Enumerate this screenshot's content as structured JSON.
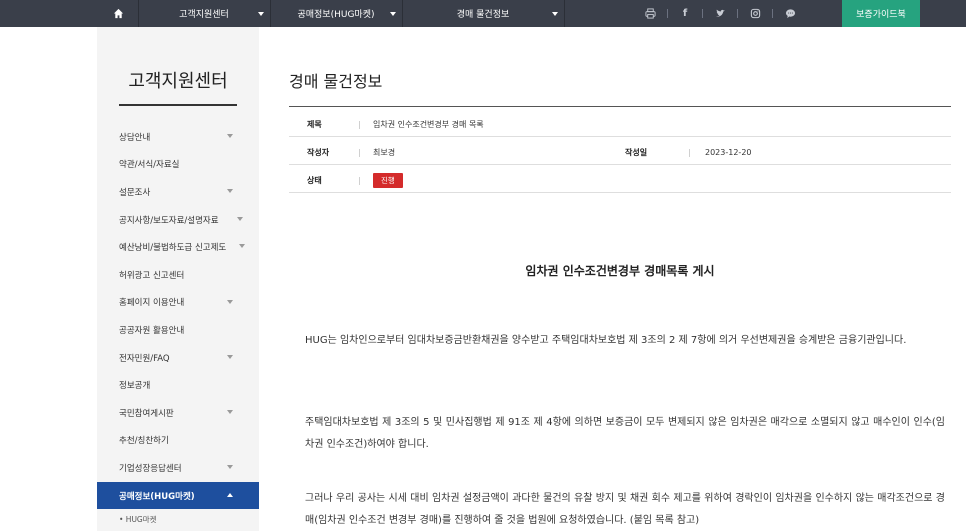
{
  "topbar": {
    "home_icon": "home-icon",
    "menus": [
      {
        "label": "고객지원센터"
      },
      {
        "label": "공매정보(HUG마켓)"
      },
      {
        "label": "경매 물건정보"
      }
    ],
    "icons": [
      "print-icon",
      "facebook-icon",
      "twitter-icon",
      "instagram-icon",
      "chat-icon"
    ],
    "guide_label": "보증가이드북",
    "colors": {
      "bar": "#3a3f4a",
      "guide": "#26a37f"
    }
  },
  "sidebar": {
    "title": "고객지원센터",
    "items": [
      {
        "label": "상담안내",
        "has_arrow": true
      },
      {
        "label": "약관/서식/자료실",
        "has_arrow": false
      },
      {
        "label": "설문조사",
        "has_arrow": true
      },
      {
        "label": "공지사항/보도자료/설명자료",
        "has_arrow": true
      },
      {
        "label": "예산낭비/불법하도급 신고제도",
        "has_arrow": true
      },
      {
        "label": "허위광고 신고센터",
        "has_arrow": false
      },
      {
        "label": "홈페이지 이용안내",
        "has_arrow": true
      },
      {
        "label": "공공자원 활용안내",
        "has_arrow": false
      },
      {
        "label": "전자민원/FAQ",
        "has_arrow": true
      },
      {
        "label": "정보공개",
        "has_arrow": false
      },
      {
        "label": "국민참여게시판",
        "has_arrow": true
      },
      {
        "label": "추천/칭찬하기",
        "has_arrow": false
      },
      {
        "label": "기업성장응답센터",
        "has_arrow": true
      },
      {
        "label": "공매정보(HUG마켓)",
        "has_arrow": true,
        "active": true
      }
    ],
    "sub_items": [
      {
        "label": "• HUG마켓"
      }
    ],
    "colors": {
      "active": "#1e4f9e"
    }
  },
  "main": {
    "page_title": "경매 물건정보",
    "fields": {
      "subject_label": "제목",
      "subject_value": "임차권 인수조건변경부 경매 목록",
      "author_label": "작성자",
      "author_value": "최보경",
      "date_label": "작성일",
      "date_value": "2023-12-20",
      "status_label": "상태",
      "status_value": "진행",
      "status_color": "#d42b2b"
    },
    "heading": "임차권 인수조건변경부 경매목록 게시",
    "paragraphs": [
      "HUG는 임차인으로부터 임대차보증금반환채권을 양수받고 주택임대차보호법 제 3조의 2 제 7항에 의거 우선변제권을 승계받은 금융기관입니다.",
      "주택임대차보호법 제 3조의 5 및 민사집행법 제 91조 제 4항에 의하면 보증금이 모두 변제되지 않은 임차권은 매각으로 소멸되지 않고 매수인이 인수(임차권 인수조건)하여야 합니다.",
      "그러나 우리 공사는 시세 대비 임차권 설정금액이 과다한 물건의 유찰 방지 및 채권 회수 제고를 위하여 경락인이 임차권을 인수하지 않는 매각조건으로 경매(임차권 인수조건 변경부 경매)를 진행하여 줄 것을 법원에 요청하였습니다. (붙임 목록 참고)"
    ]
  }
}
